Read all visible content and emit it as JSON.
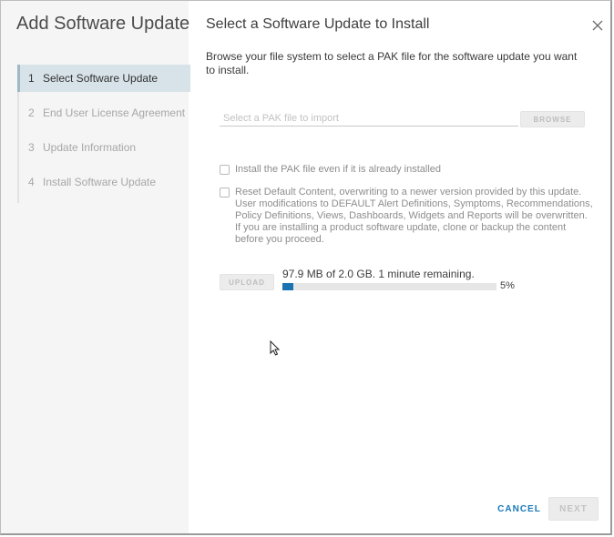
{
  "wizard": {
    "title": "Add Software Update",
    "steps": [
      {
        "num": "1",
        "label": "Select Software Update",
        "active": true
      },
      {
        "num": "2",
        "label": "End User License Agreement",
        "active": false
      },
      {
        "num": "3",
        "label": "Update Information",
        "active": false
      },
      {
        "num": "4",
        "label": "Install Software Update",
        "active": false
      }
    ]
  },
  "page": {
    "title": "Select a Software Update to Install",
    "description": "Browse your file system to select a PAK file for the software update you want to install.",
    "file_input": {
      "value": "",
      "placeholder": "Select a PAK file to import"
    },
    "browse_label": "BROWSE",
    "options": [
      {
        "label": "Install the PAK file even if it is already installed",
        "checked": false
      },
      {
        "label": "Reset Default Content, overwriting to a newer version provided by this update. User modifications to DEFAULT Alert Definitions, Symptoms, Recommendations, Policy Definitions, Views, Dashboards, Widgets and Reports will be overwritten. If you are installing a product software update, clone or backup the content before you proceed.",
        "checked": false
      }
    ],
    "upload_label": "UPLOAD",
    "progress": {
      "text": "97.9 MB of 2.0 GB. 1 minute remaining.",
      "percent": 5,
      "percent_label": "5%"
    }
  },
  "footer": {
    "cancel_label": "CANCEL",
    "next_label": "NEXT"
  },
  "colors": {
    "accent": "#1b79b9",
    "progress": "#1a73b0",
    "active_step_bg": "#d8e3e9"
  },
  "icons": {
    "close": "close-icon",
    "cursor": "mouse-pointer-icon"
  }
}
